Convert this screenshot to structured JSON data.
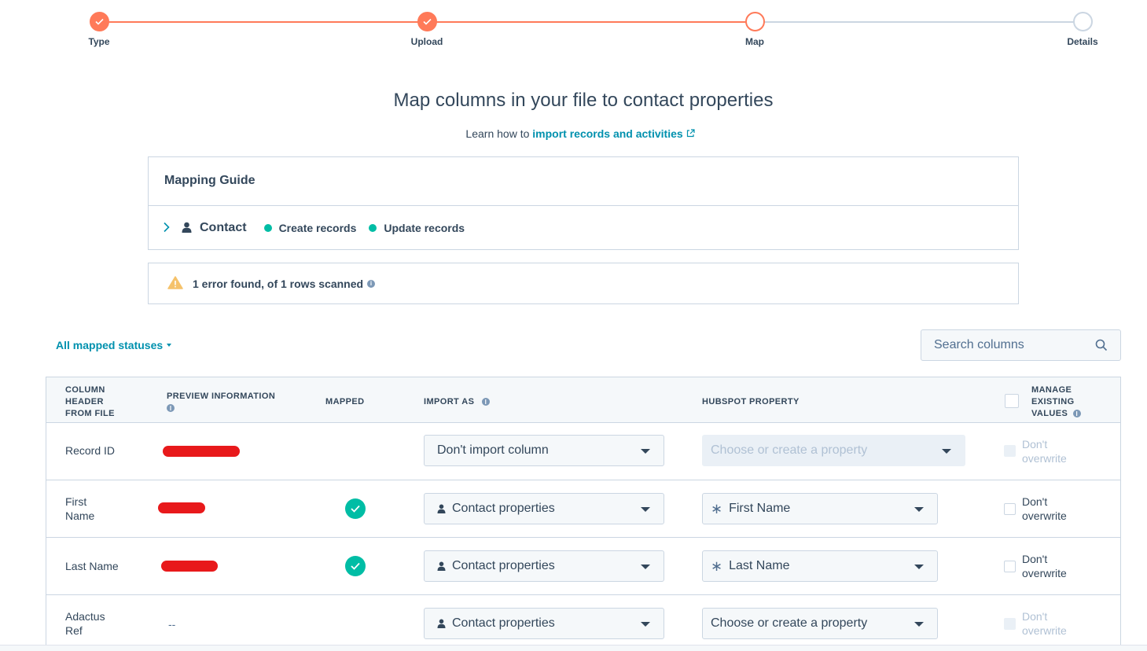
{
  "stepper": {
    "steps": [
      {
        "label": "Type",
        "state": "done"
      },
      {
        "label": "Upload",
        "state": "done"
      },
      {
        "label": "Map",
        "state": "current"
      },
      {
        "label": "Details",
        "state": "todo"
      }
    ],
    "accent": "#ff7a59"
  },
  "header": {
    "title": "Map columns in your file to contact properties",
    "learn_prefix": "Learn how to",
    "learn_link": "import records and activities"
  },
  "guide": {
    "title": "Mapping Guide",
    "object": "Contact",
    "statuses": [
      "Create records",
      "Update records"
    ],
    "status_color": "#00bda5"
  },
  "errors": {
    "text": "1 error found, of 1 rows scanned"
  },
  "filter": {
    "label": "All mapped statuses"
  },
  "search": {
    "placeholder": "Search columns"
  },
  "table": {
    "headers": {
      "column_header": "COLUMN HEADER FROM FILE",
      "preview": "PREVIEW INFORMATION",
      "mapped": "MAPPED",
      "import_as": "IMPORT AS",
      "hubspot_property": "HUBSPOT PROPERTY",
      "manage": "MANAGE EXISTING VALUES"
    },
    "rows": [
      {
        "column": "Record ID",
        "preview": "",
        "mapped": false,
        "import_as": "Don't import column",
        "property": "Choose or create a property",
        "overwrite": "Don't overwrite"
      },
      {
        "column": "First Name",
        "preview": "",
        "mapped": true,
        "import_as": "Contact properties",
        "property": "First Name",
        "overwrite": "Don't overwrite"
      },
      {
        "column": "Last Name",
        "preview": "",
        "mapped": true,
        "import_as": "Contact properties",
        "property": "Last Name",
        "overwrite": "Don't overwrite"
      },
      {
        "column": "Adactus Ref",
        "preview": "--",
        "mapped": false,
        "import_as": "Contact properties",
        "property": "Choose or create a property",
        "overwrite": "Don't overwrite"
      }
    ]
  }
}
